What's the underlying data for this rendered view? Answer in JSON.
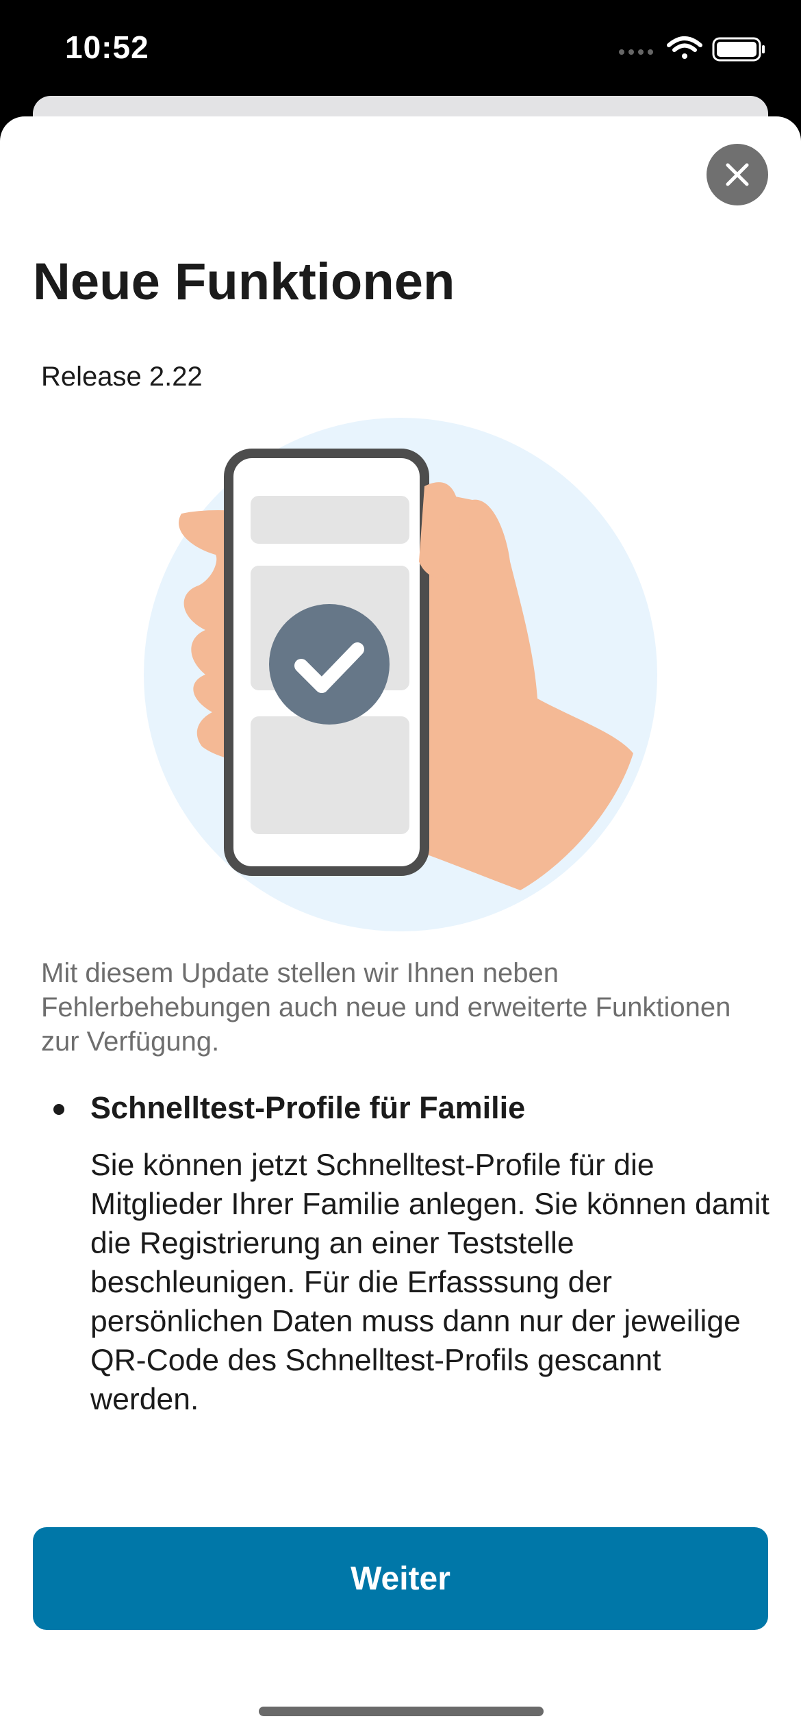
{
  "status_bar": {
    "time": "10:52"
  },
  "sheet": {
    "close_icon": "close-icon",
    "title": "Neue Funktionen",
    "release": "Release 2.22",
    "illustration_icon": "phone-in-hand-checkmark-illustration",
    "intro": "Mit diesem Update stellen wir Ihnen neben Fehlerbehebungen auch neue und erweiterte Funktionen zur Verfügung.",
    "features": [
      {
        "title": "Schnelltest-Profile für Familie",
        "body": "Sie können jetzt Schnelltest-Profile für die Mitglieder Ihrer Familie anlegen. Sie können damit die Registrierung an einer Teststelle beschleunigen. Für die Erfasssung der persönlichen Daten muss dann nur der jeweilige QR-Code des Schnelltest-Profils gescannt werden."
      }
    ],
    "continue_label": "Weiter"
  },
  "colors": {
    "accent": "#0077a8",
    "illustration_bg": "#e8f4fd",
    "hand": "#f4b995",
    "check_circle": "#667788"
  }
}
